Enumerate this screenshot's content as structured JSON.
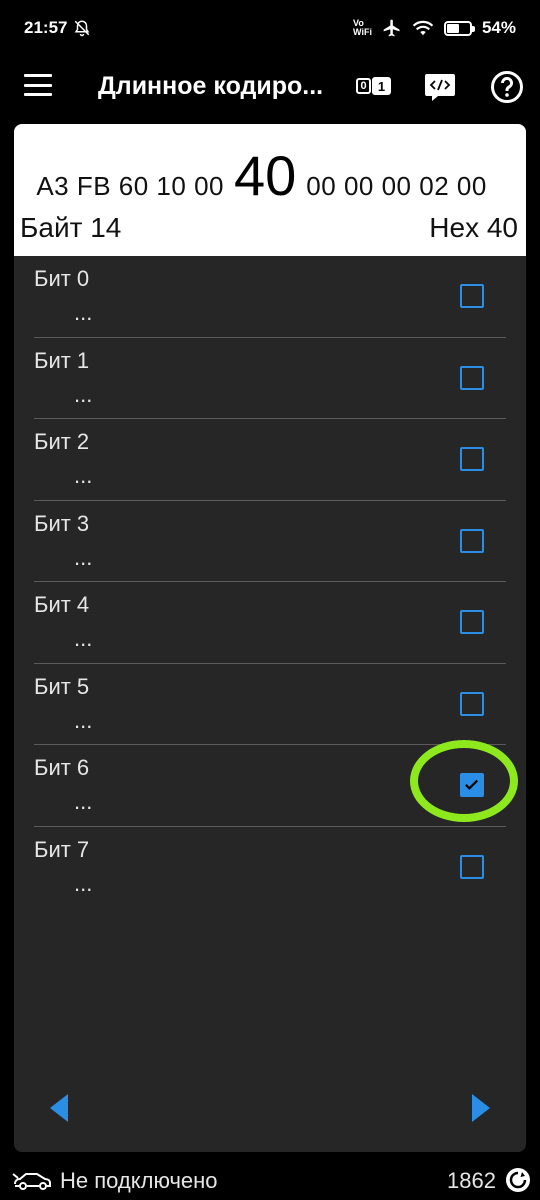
{
  "status_bar": {
    "time": "21:57",
    "vowifi_top": "Vo",
    "vowifi_bottom": "WiFi",
    "battery": "54%",
    "battery_level": 0.54
  },
  "app_bar": {
    "title": "Длинное кодиро...",
    "bit_icon_zero": "0",
    "bit_icon_one": "1"
  },
  "hex_view": {
    "before": "A3 FB 60 10 00",
    "current": "40",
    "after": "00 00 00 02 00",
    "byte_label": "Байт 14",
    "hex_label": "Hex 40"
  },
  "bits": [
    {
      "name": "Бит 0",
      "desc": "...",
      "checked": false
    },
    {
      "name": "Бит 1",
      "desc": "...",
      "checked": false
    },
    {
      "name": "Бит 2",
      "desc": "...",
      "checked": false
    },
    {
      "name": "Бит 3",
      "desc": "...",
      "checked": false
    },
    {
      "name": "Бит 4",
      "desc": "...",
      "checked": false
    },
    {
      "name": "Бит 5",
      "desc": "...",
      "checked": false
    },
    {
      "name": "Бит 6",
      "desc": "...",
      "checked": true
    },
    {
      "name": "Бит 7",
      "desc": "...",
      "checked": false
    }
  ],
  "footer": {
    "connection_status": "Не подключено",
    "counter": "1862"
  },
  "colors": {
    "accent": "#2a8ee6",
    "highlight": "#8ee81e",
    "panel": "#262626"
  },
  "icons": {
    "mute": "bell-off-icon",
    "airplane": "airplane-icon",
    "wifi": "wifi-icon",
    "menu": "menu-icon",
    "code": "code-icon",
    "help": "help-icon",
    "car": "car-icon",
    "sync": "sync-icon"
  }
}
